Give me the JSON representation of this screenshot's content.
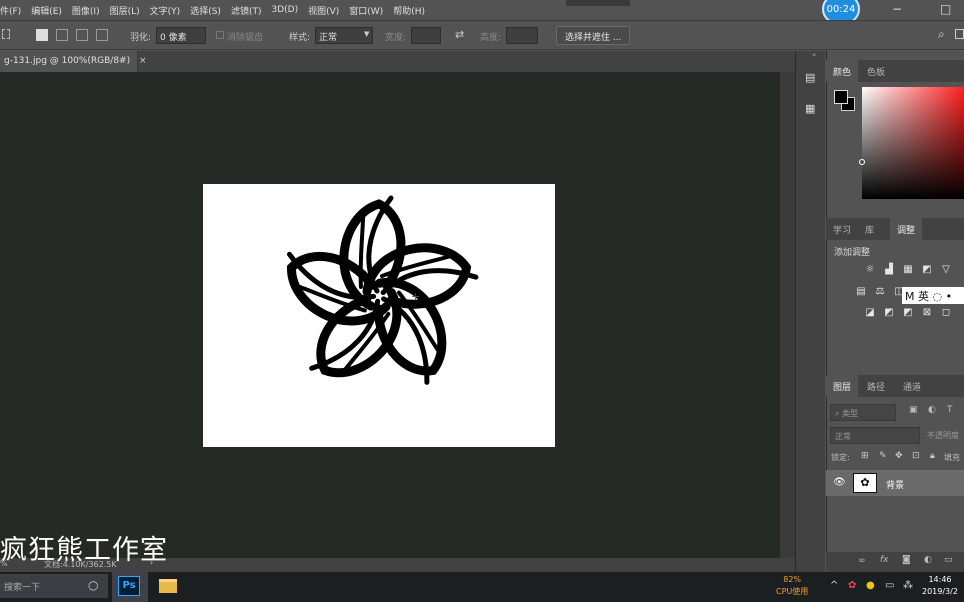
{
  "menu": [
    "件(F)",
    "编辑(E)",
    "图像(I)",
    "图层(L)",
    "文字(Y)",
    "选择(S)",
    "滤镜(T)",
    "3D(D)",
    "视图(V)",
    "窗口(W)",
    "帮助(H)"
  ],
  "recording_timer": "00:24",
  "window_controls": {
    "minimize": "−",
    "restore": "□"
  },
  "options": {
    "feather_label": "羽化:",
    "feather_value": "0 像素",
    "antialias_label": "消除锯齿",
    "style_label": "样式:",
    "style_value": "正常",
    "width_label": "宽度:",
    "height_label": "高度:",
    "select_mask_button": "选择并遮住 ..."
  },
  "document_tab": {
    "title": "g-131.jpg @ 100%(RGB/8#)",
    "close": "×"
  },
  "status": {
    "zoom": "%",
    "doc_info": "文档:4.10K/362.5K"
  },
  "watermark": "疯狂熊工作室",
  "color_panel": {
    "tabs": [
      "颜色",
      "色板"
    ],
    "active": 0
  },
  "adjust_panel": {
    "tabs": [
      "学习",
      "库",
      "调整"
    ],
    "active": 2,
    "heading": "添加调整"
  },
  "ime": {
    "text": "M 英 ◌ •"
  },
  "layers_panel": {
    "tabs": [
      "图层",
      "路径",
      "通道"
    ],
    "active": 0,
    "kind_filter": "类型",
    "blend_mode": "正常",
    "opacity_label": "不透明度",
    "lock_label": "锁定:",
    "fill_label": "填充",
    "layers": [
      {
        "name": "背景",
        "visible": true
      }
    ]
  },
  "taskbar": {
    "search_placeholder": "搜索一下",
    "ps_label": "Ps",
    "cpu_percent": "82%",
    "cpu_label": "CPU使用",
    "time": "14:46",
    "date": "2019/3/2"
  }
}
